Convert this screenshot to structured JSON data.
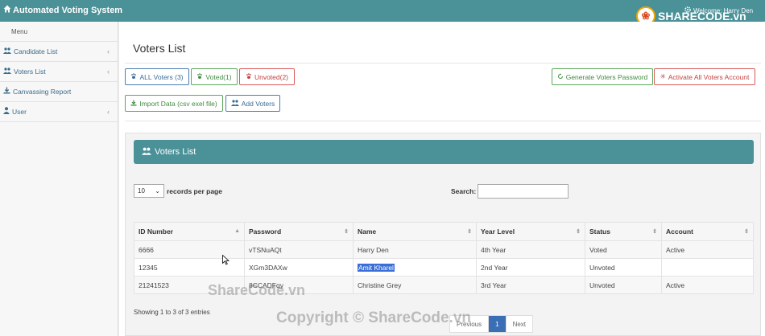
{
  "app": {
    "title": "Automated Voting System",
    "welcome": "Welcome: Harry Den"
  },
  "logo": {
    "text": "SHARECODE.vn"
  },
  "sidebar": {
    "menu_title": "Menu",
    "items": [
      {
        "label": "Candidate List",
        "icon": "users-icon",
        "has_submenu": true
      },
      {
        "label": "Voters List",
        "icon": "users-icon",
        "has_submenu": true
      },
      {
        "label": "Canvassing Report",
        "icon": "download-icon",
        "has_submenu": false
      },
      {
        "label": "User",
        "icon": "user-icon",
        "has_submenu": true
      }
    ]
  },
  "page": {
    "title": "Voters List"
  },
  "filters": {
    "all": "ALL Voters (3)",
    "voted": "Voted(1)",
    "unvoted": "Unvoted(2)"
  },
  "actions": {
    "generate": "Generate Voters Password",
    "activate": "Activate All Voters Account",
    "import": "Import Data (csv exel file)",
    "add": "Add Voters"
  },
  "panel": {
    "title": "Voters List"
  },
  "table": {
    "length_value": "10",
    "length_label": "records per page",
    "search_label": "Search:",
    "columns": [
      "ID Number",
      "Password",
      "Name",
      "Year Level",
      "Status",
      "Account"
    ],
    "rows": [
      [
        "6666",
        "vTSNuAQt",
        "Harry Den",
        "4th Year",
        "Voted",
        "Active"
      ],
      [
        "12345",
        "XGm3DAXw",
        "Amit Kharel",
        "2nd Year",
        "Unvoted",
        ""
      ],
      [
        "21241523",
        "8CCADFqy",
        "Christine Grey",
        "3rd Year",
        "Unvoted",
        "Active"
      ]
    ],
    "info": "Showing 1 to 3 of 3 entries",
    "pager": {
      "previous": "Previous",
      "page": "1",
      "next": "Next"
    }
  },
  "watermarks": {
    "center": "ShareCode.vn",
    "bottom": "Copyright © ShareCode.vn"
  },
  "colors": {
    "teal": "#4a9198",
    "blue": "#3a6c9a",
    "green": "#3f8c3f",
    "red": "#c64040"
  }
}
